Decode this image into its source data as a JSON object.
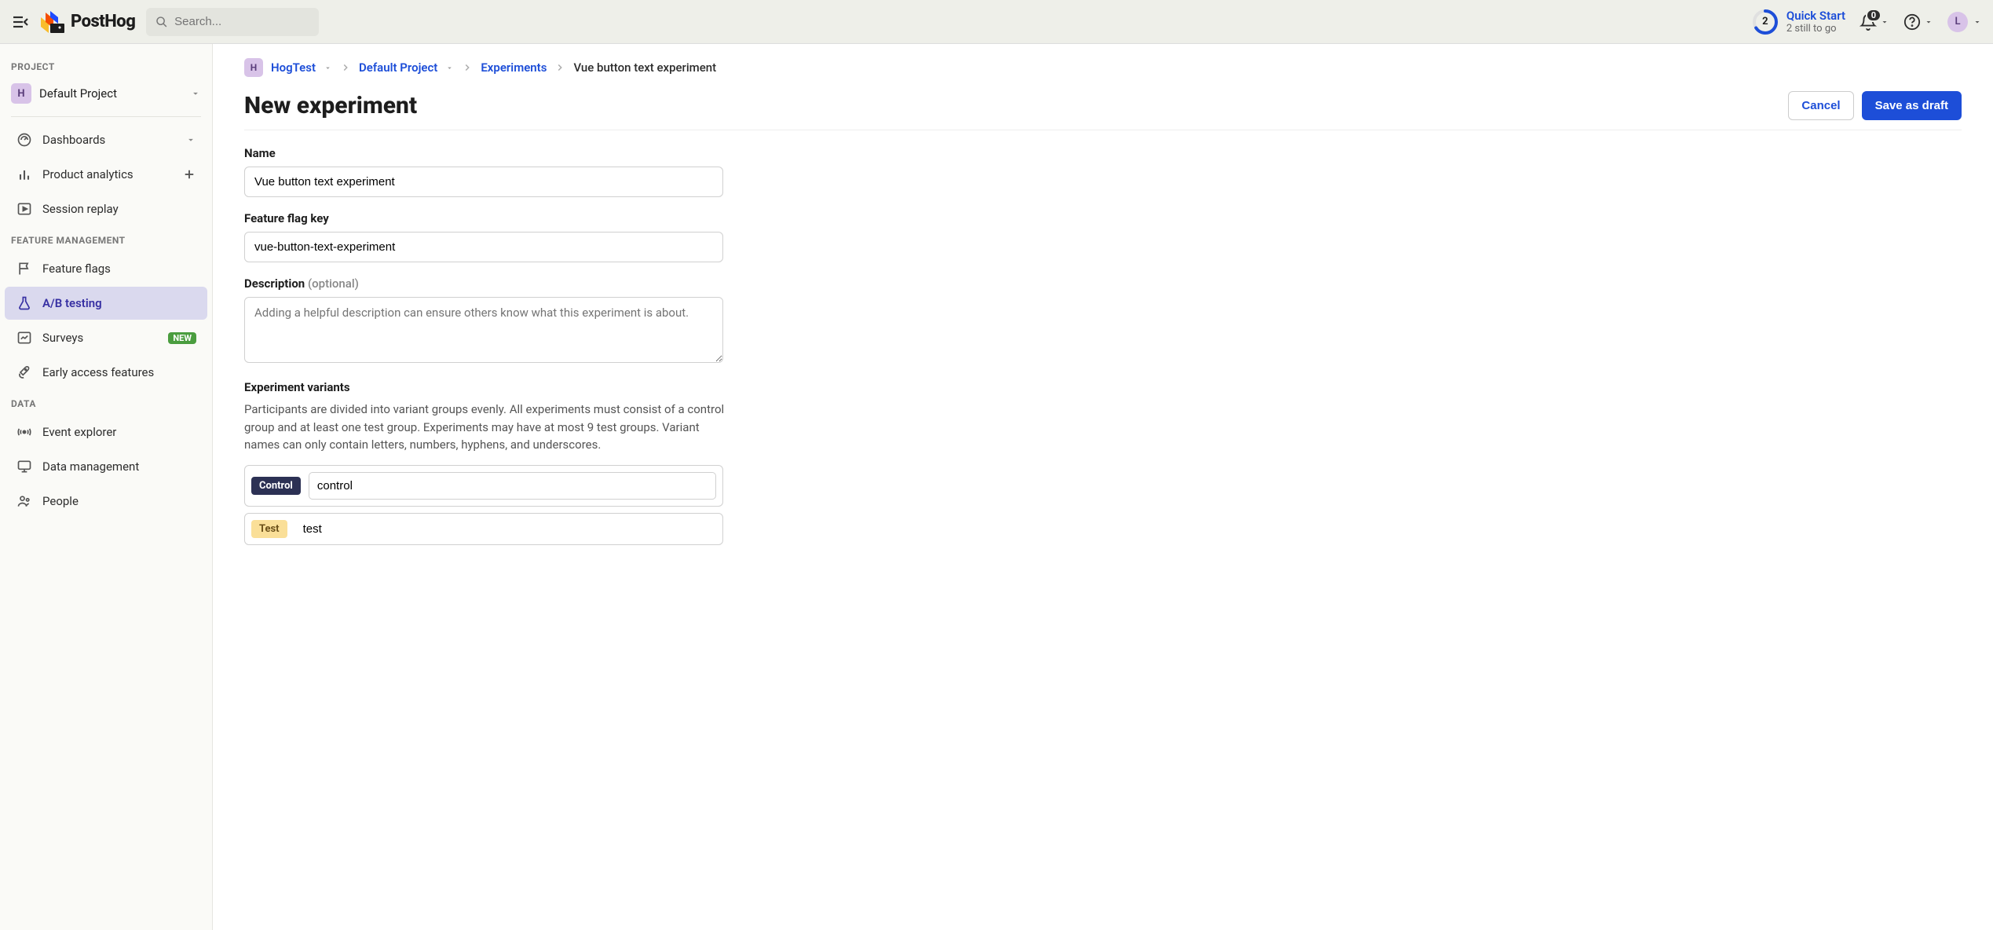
{
  "topbar": {
    "logo_text": "PostHog",
    "search_placeholder": "Search...",
    "quickstart": {
      "count": "2",
      "title": "Quick Start",
      "subtitle": "2 still to go"
    },
    "notif_count": "0",
    "avatar_initial": "L"
  },
  "sidebar": {
    "section_project": "PROJECT",
    "project": {
      "badge": "H",
      "name": "Default Project"
    },
    "items": [
      {
        "label": "Dashboards",
        "icon": "gauge",
        "trailing": "caret"
      },
      {
        "label": "Product analytics",
        "icon": "bars",
        "trailing": "plus"
      },
      {
        "label": "Session replay",
        "icon": "play",
        "trailing": ""
      }
    ],
    "section_feature": "FEATURE MANAGEMENT",
    "feature_items": [
      {
        "label": "Feature flags",
        "icon": "flag"
      },
      {
        "label": "A/B testing",
        "icon": "flask",
        "active": true
      },
      {
        "label": "Surveys",
        "icon": "chart",
        "badge": "NEW"
      },
      {
        "label": "Early access features",
        "icon": "rocket"
      }
    ],
    "section_data": "DATA",
    "data_items": [
      {
        "label": "Event explorer",
        "icon": "live"
      },
      {
        "label": "Data management",
        "icon": "monitor"
      },
      {
        "label": "People",
        "icon": "people"
      }
    ]
  },
  "breadcrumb": {
    "badge": "H",
    "org": "HogTest",
    "project": "Default Project",
    "section": "Experiments",
    "current": "Vue button text experiment"
  },
  "page": {
    "title": "New experiment",
    "cancel": "Cancel",
    "save": "Save as draft"
  },
  "form": {
    "name_label": "Name",
    "name_value": "Vue button text experiment",
    "flag_label": "Feature flag key",
    "flag_value": "vue-button-text-experiment",
    "desc_label": "Description",
    "desc_optional": "(optional)",
    "desc_placeholder": "Adding a helpful description can ensure others know what this experiment is about.",
    "variants_label": "Experiment variants",
    "variants_help": "Participants are divided into variant groups evenly. All experiments must consist of a control group and at least one test group. Experiments may have at most 9 test groups. Variant names can only contain letters, numbers, hyphens, and underscores.",
    "variants": [
      {
        "tag": "Control",
        "kind": "control",
        "value": "control"
      },
      {
        "tag": "Test",
        "kind": "test",
        "value": "test"
      }
    ]
  }
}
